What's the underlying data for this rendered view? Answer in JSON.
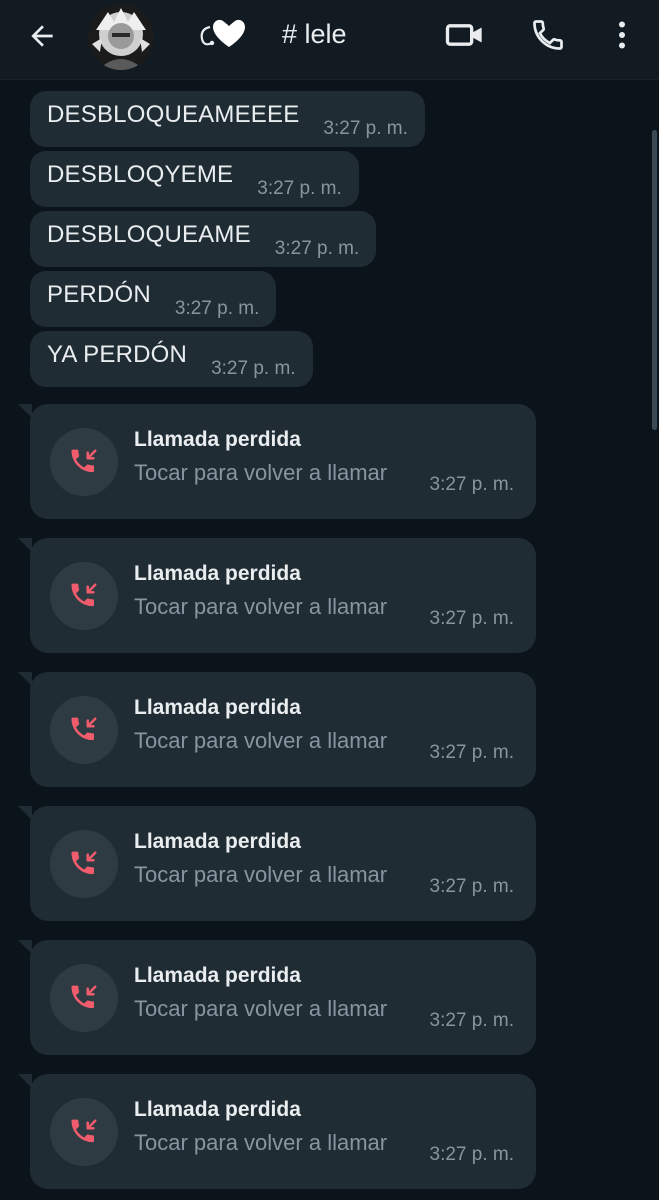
{
  "header": {
    "contact_name": "# lele",
    "contact_decoration": "ʿ🤍",
    "icons": [
      "back-arrow-icon",
      "avatar",
      "video-call-icon",
      "voice-call-icon",
      "more-vert-icon"
    ]
  },
  "messages": [
    {
      "text": "DESBLOQUEAMEEEE",
      "time": "3:27 p. m."
    },
    {
      "text": "DESBLOQYEME",
      "time": "3:27 p. m."
    },
    {
      "text": "DESBLOQUEAME",
      "time": "3:27 p. m."
    },
    {
      "text": "PERDÓN",
      "time": "3:27 p. m."
    },
    {
      "text": "YA PERDÓN",
      "time": "3:27 p. m."
    }
  ],
  "missed_calls": [
    {
      "title": "Llamada perdida",
      "subtitle": "Tocar para volver a llamar",
      "time": "3:27 p. m."
    },
    {
      "title": "Llamada perdida",
      "subtitle": "Tocar para volver a llamar",
      "time": "3:27 p. m."
    },
    {
      "title": "Llamada perdida",
      "subtitle": "Tocar para volver a llamar",
      "time": "3:27 p. m."
    },
    {
      "title": "Llamada perdida",
      "subtitle": "Tocar para volver a llamar",
      "time": "3:27 p. m."
    },
    {
      "title": "Llamada perdida",
      "subtitle": "Tocar para volver a llamar",
      "time": "3:27 p. m."
    },
    {
      "title": "Llamada perdida",
      "subtitle": "Tocar para volver a llamar",
      "time": "3:27 p. m."
    }
  ],
  "colors": {
    "background": "#0b141a",
    "header": "#121b22",
    "bubble": "#202c33",
    "missed_call_red": "#f15c6d",
    "secondary_text": "#8696a0"
  }
}
